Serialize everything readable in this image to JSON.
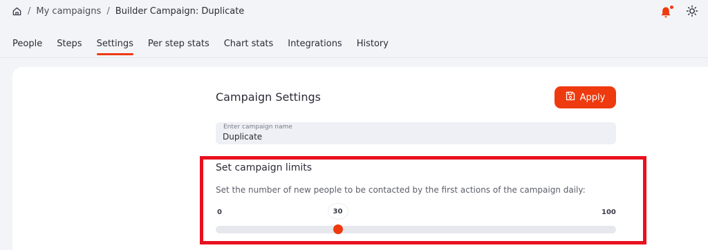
{
  "breadcrumb": {
    "home_icon": "home-icon",
    "separator": "/",
    "items": [
      "My campaigns",
      "Builder Campaign: Duplicate"
    ]
  },
  "header_icons": {
    "notifications_icon": "bell-icon",
    "theme_icon": "sun-icon",
    "notification_dot_color": "#ee3a0e"
  },
  "tabs": [
    {
      "label": "People",
      "active": false
    },
    {
      "label": "Steps",
      "active": false
    },
    {
      "label": "Settings",
      "active": true
    },
    {
      "label": "Per step stats",
      "active": false
    },
    {
      "label": "Chart stats",
      "active": false
    },
    {
      "label": "Integrations",
      "active": false
    },
    {
      "label": "History",
      "active": false
    }
  ],
  "settings": {
    "title": "Campaign Settings",
    "apply_label": "Apply",
    "apply_icon": "save-icon",
    "name_field": {
      "label": "Enter campaign name",
      "value": "Duplicate"
    }
  },
  "limits": {
    "title": "Set campaign limits",
    "description": "Set the number of new people to be contacted by the first actions of the campaign daily:",
    "min": 0,
    "max": 100,
    "value": 30,
    "min_label": "0",
    "max_label": "100",
    "value_label": "30"
  },
  "colors": {
    "accent": "#ee3a0e",
    "highlight": "#e8101e"
  }
}
